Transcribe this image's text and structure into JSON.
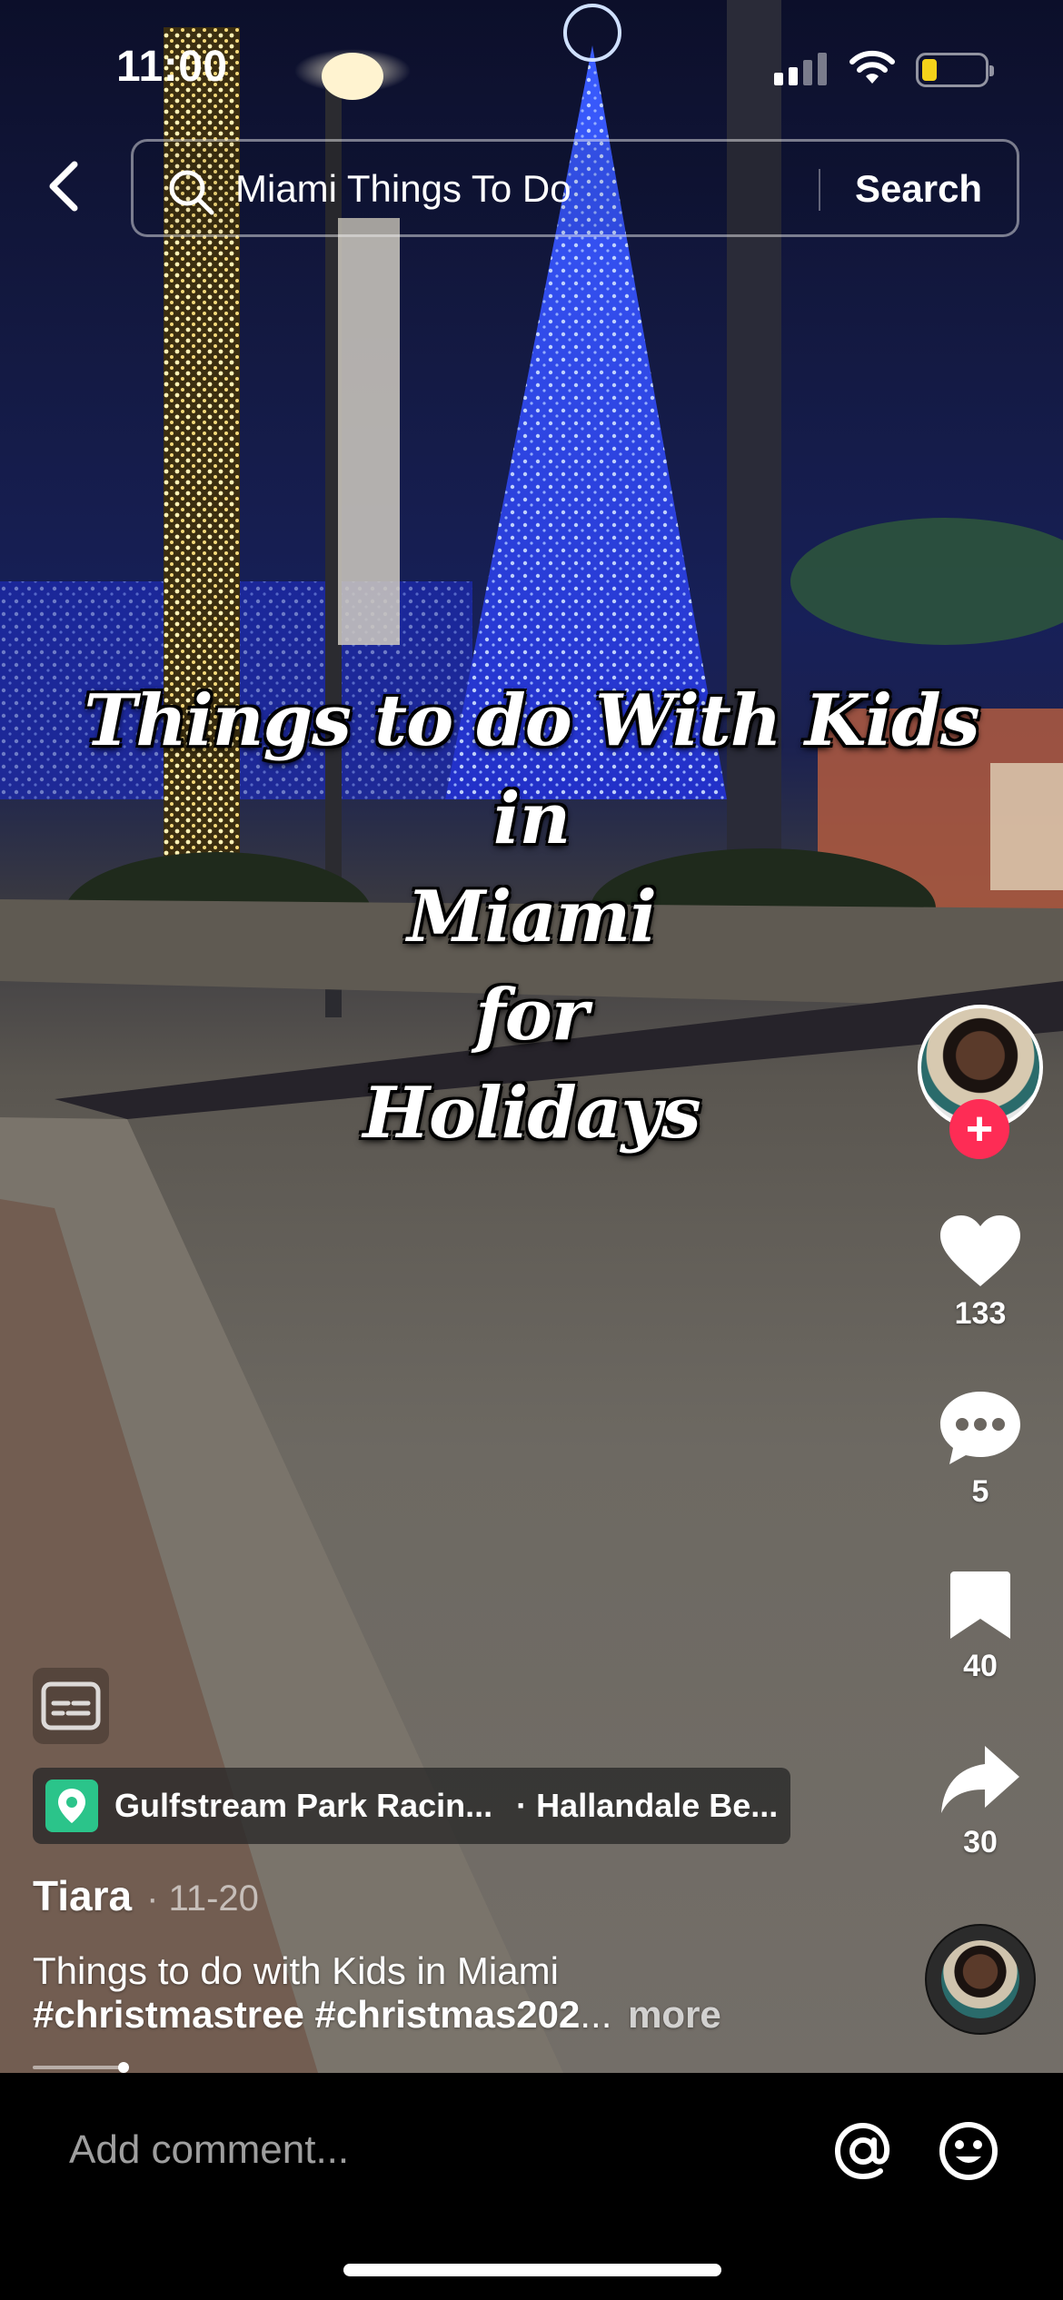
{
  "status_bar": {
    "time": "11:00",
    "signal_icon": "cellular-signal-icon",
    "wifi_icon": "wifi-icon",
    "battery_icon": "battery-low-icon",
    "battery_color": "#f4d21a"
  },
  "header": {
    "back_icon": "chevron-left-icon",
    "search_icon": "search-icon",
    "search_query": "Miami Things To Do",
    "search_button": "Search"
  },
  "video": {
    "caption_lines": [
      "Things to do With Kids in",
      "Miami",
      "for",
      "Holidays"
    ]
  },
  "right_rail": {
    "avatar_icon": "creator-avatar",
    "follow_label": "+",
    "follow_color": "#fe2c55",
    "likes": "133",
    "comments": "5",
    "bookmarks": "40",
    "shares": "30",
    "like_icon": "heart-icon",
    "comment_icon": "comment-bubble-icon",
    "bookmark_icon": "bookmark-icon",
    "share_icon": "share-arrow-icon",
    "music_icon": "music-disc-avatar"
  },
  "info": {
    "captions_icon": "closed-captions-icon",
    "location_icon": "location-pin-icon",
    "location_color": "#2bc48a",
    "location_name": "Gulfstream Park Racin...",
    "location_separator": "·",
    "location_city": "Hallandale Be...",
    "author": "Tiara",
    "date": "· 11-20",
    "description_line1": "Things to do with Kids in Miami",
    "description_tags": "#christmastree #christmas202",
    "description_ellipsis": "...",
    "more_label": "more"
  },
  "comment_bar": {
    "placeholder": "Add comment...",
    "mention_icon": "at-mention-icon",
    "emoji_icon": "emoji-icon"
  }
}
